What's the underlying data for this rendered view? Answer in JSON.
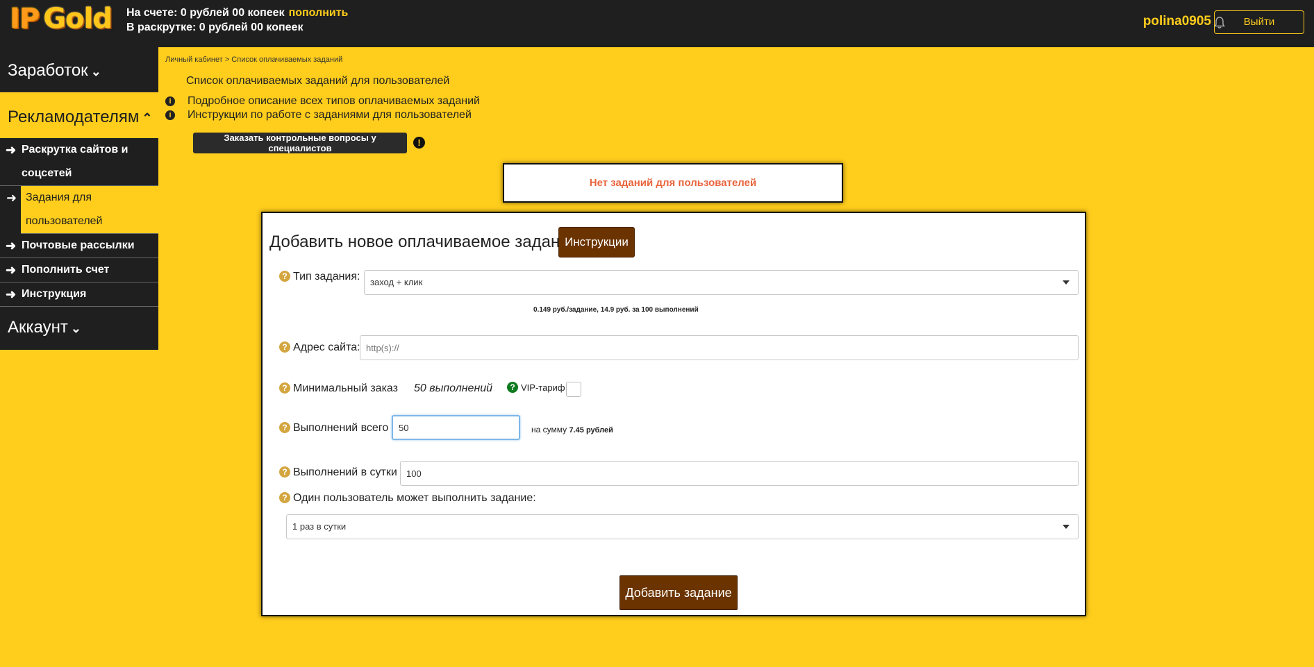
{
  "header": {
    "logo_ip": "IP",
    "logo_gold": "Gold",
    "balance_label": "На счете: 0 рублей 00 копеек",
    "topup_link": "пополнить",
    "promo_balance": "В раскрутке: 0 рублей 00 копеек",
    "username": "polina0905",
    "logout_label": "Выйти"
  },
  "sidebar": {
    "earnings": "Заработок",
    "advertisers": "Рекламодателям",
    "items": [
      {
        "label1": "Раскрутка сайтов и",
        "label2": "соцсетей"
      },
      {
        "label1": "Задания для",
        "label2": "пользователей"
      },
      {
        "label1": "Почтовые рассылки"
      },
      {
        "label1": "Пополнить счет"
      },
      {
        "label1": "Инструкция"
      }
    ],
    "account": "Аккаунт"
  },
  "main": {
    "breadcrumb": "Личный кабинет > Список оплачиваемых заданий",
    "title": "Список оплачиваемых заданий для пользователей",
    "info1": "Подробное описание всех типов оплачиваемых заданий",
    "info2": "Инструкции по работе с заданиями для пользователей",
    "order_button": "Заказать контрольные вопросы у специалистов",
    "no_tasks": "Нет заданий для пользователей"
  },
  "form": {
    "title": "Добавить новое оплачиваемое задание",
    "instructions_button": "Инструкции",
    "task_type_label": "Тип задания:",
    "task_type_value": "заход + клик",
    "price_note": "0.149 руб./задание, 14.9 руб. за 100 выполнений",
    "site_label": "Адрес сайта:",
    "site_placeholder": "http(s)://",
    "min_order_label": "Минимальный заказ",
    "min_order_value": "50 выполнений",
    "vip_label": "VIP-тариф",
    "total_label": "Выполнений всего",
    "total_value": "50",
    "sum_label": "на сумму",
    "sum_value": "7.45 рублей",
    "per_day_label": "Выполнений в сутки",
    "per_day_value": "100",
    "one_user_label": "Один пользователь может выполнить задание:",
    "one_user_value": "1 раз в сутки",
    "submit": "Добавить задание"
  },
  "colors": {
    "background": "#FFCD1C",
    "dark": "#1F1F1F",
    "button_brown": "#6B3300",
    "notice_text": "#E8643C"
  }
}
